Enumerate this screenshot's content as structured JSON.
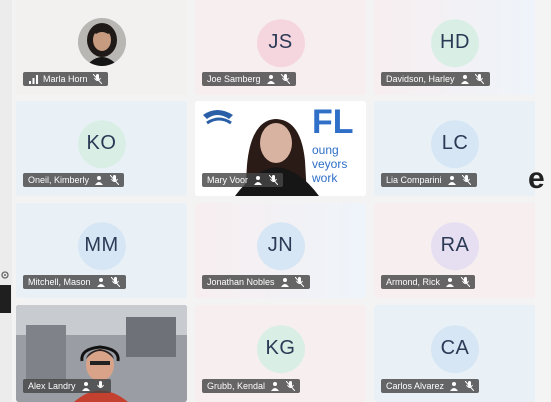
{
  "participants": [
    {
      "name": "Marla Horn",
      "type": "photo"
    },
    {
      "name": "Joe Samberg",
      "initials": "JS"
    },
    {
      "name": "Davidson, Harley",
      "initials": "HD"
    },
    {
      "name": "Oneil, Kimberly",
      "initials": "KO"
    },
    {
      "name": "Mary Voor",
      "type": "video"
    },
    {
      "name": "Lia Comparini",
      "initials": "LC"
    },
    {
      "name": "Mitchell, Mason",
      "initials": "MM"
    },
    {
      "name": "Jonathan Nobles",
      "initials": "JN"
    },
    {
      "name": "Armond, Rick",
      "initials": "RA"
    },
    {
      "name": "Alex Landry",
      "type": "video"
    },
    {
      "name": "Grubb, Kendal",
      "initials": "KG"
    },
    {
      "name": "Carlos Alvarez",
      "initials": "CA"
    }
  ],
  "background_logo": {
    "letters": "FL",
    "line1": "oung",
    "line2": "veyors",
    "line3": "work"
  },
  "edge_letter": "e",
  "colors": {
    "nameplate_bg": "#464646",
    "initials_text": "#2b3a55",
    "logo_blue": "#2f6fc7"
  }
}
